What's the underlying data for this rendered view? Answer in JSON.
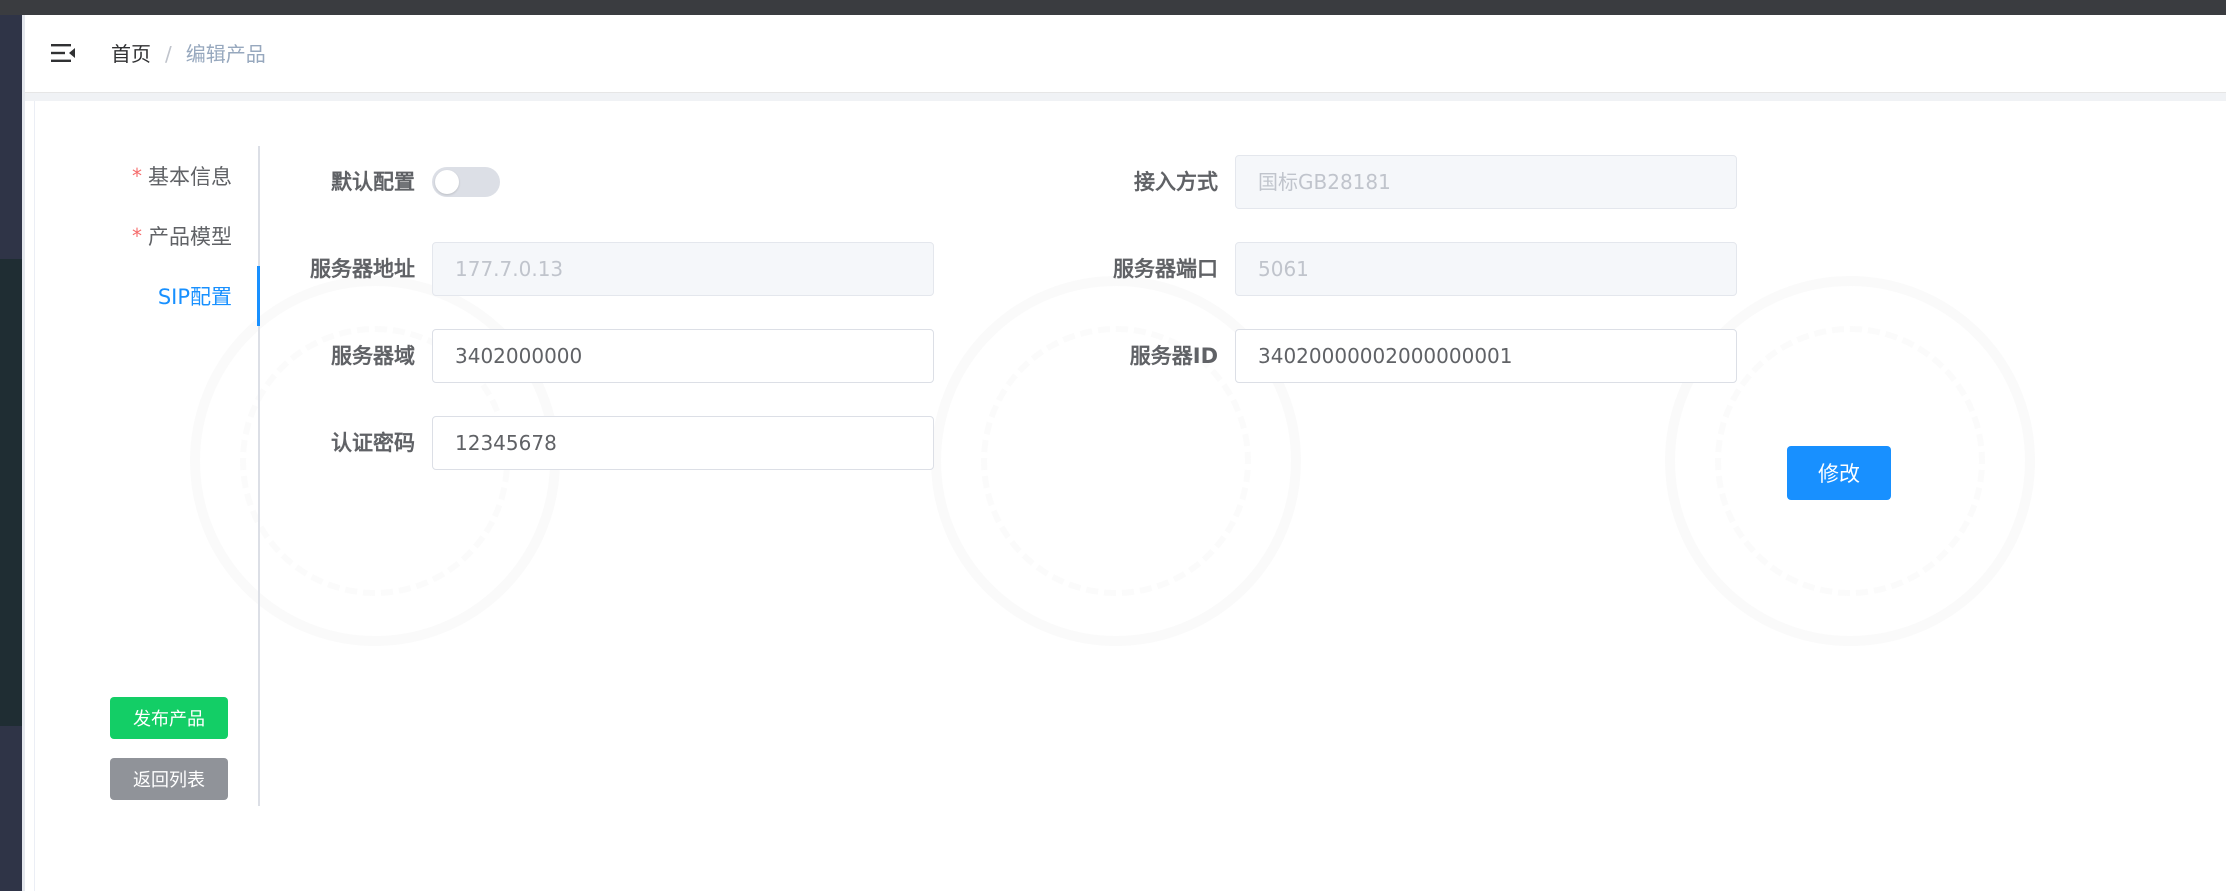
{
  "breadcrumb": {
    "home": "首页",
    "separator": "/",
    "current": "编辑产品"
  },
  "steps": [
    {
      "label": "基本信息",
      "required": true,
      "active": false
    },
    {
      "label": "产品模型",
      "required": true,
      "active": false
    },
    {
      "label": "SIP配置",
      "required": false,
      "active": true
    }
  ],
  "required_mark": "*",
  "actions": {
    "publish": "发布产品",
    "back": "返回列表",
    "modify": "修改"
  },
  "form": {
    "default_config": {
      "label": "默认配置",
      "enabled": false
    },
    "access_method": {
      "label": "接入方式",
      "value": "国标GB28181"
    },
    "server_address": {
      "label": "服务器地址",
      "value": "177.7.0.13"
    },
    "server_port": {
      "label": "服务器端口",
      "value": "5061"
    },
    "server_domain": {
      "label": "服务器域",
      "value": "3402000000"
    },
    "server_id": {
      "label": "服务器ID",
      "value": "34020000002000000001"
    },
    "auth_password": {
      "label": "认证密码",
      "value": "12345678"
    }
  },
  "colors": {
    "primary": "#1890ff",
    "success": "#13ce66",
    "info": "#909399",
    "required": "#f56c6c"
  }
}
